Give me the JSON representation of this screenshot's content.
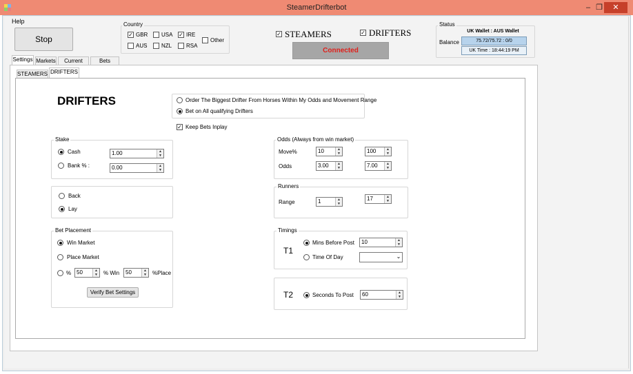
{
  "window": {
    "title": "SteamerDrifterbot",
    "minimize_glyph": "–",
    "restore_glyph": "❐",
    "close_glyph": "✕"
  },
  "menu": {
    "help": "Help"
  },
  "stop_button": "Stop",
  "country": {
    "legend": "Country",
    "options": [
      {
        "label": "GBR",
        "checked": true
      },
      {
        "label": "USA",
        "checked": false
      },
      {
        "label": "IRE",
        "checked": true
      },
      {
        "label": "AUS",
        "checked": false
      },
      {
        "label": "NZL",
        "checked": false
      },
      {
        "label": "RSA",
        "checked": false
      },
      {
        "label": "Other",
        "checked": false
      }
    ]
  },
  "mode": {
    "steamers_label": "STEAMERS",
    "steamers_checked": true,
    "drifters_label": "DRIFTERS",
    "drifters_checked": true
  },
  "connection": {
    "text": "Connected",
    "bg_color": "#a6a6a6",
    "text_color": "#e0201b"
  },
  "status": {
    "legend": "Status",
    "wallet_header": "UK Wallet : AUS Wallet",
    "balance_label": "Balance",
    "balance_value": "75.72/75.72 : 0/0",
    "uk_time": "UK Time : 18:44:19 PM"
  },
  "main_tabs": [
    "Settings",
    "Markets",
    "Current Bets",
    "Bets History"
  ],
  "sub_tabs": [
    "STEAMERS",
    "DRIFTERS"
  ],
  "drifters": {
    "heading": "DRIFTERS",
    "order_options": [
      {
        "label": "Order The Biggest Drifter From Horses Within My Odds and Movement Range",
        "selected": false
      },
      {
        "label": "Bet on All qualifying Drifters",
        "selected": true
      }
    ],
    "keep_inplay": {
      "label": "Keep Bets Inplay",
      "checked": true
    },
    "stake": {
      "legend": "Stake",
      "cash_label": "Cash",
      "cash_selected": true,
      "cash_value": "1.00",
      "bank_label": "Bank % :",
      "bank_selected": false,
      "bank_value": "0.00"
    },
    "side": {
      "back_label": "Back",
      "back_selected": false,
      "lay_label": "Lay",
      "lay_selected": true
    },
    "bet_placement": {
      "legend": "Bet Placement",
      "win_label": "Win Market",
      "win_selected": true,
      "place_label": "Place Market",
      "place_selected": false,
      "pct_label": "%",
      "pct_selected": false,
      "win_pct_value": "50",
      "win_pct_label": "% Win",
      "place_pct_value": "50",
      "place_pct_label": "%Place",
      "verify_button": "Verify Bet Settings"
    },
    "odds": {
      "legend": "Odds (Always from win market)",
      "move_label": "Move%",
      "move_min": "10",
      "move_max": "100",
      "odds_label": "Odds",
      "odds_min": "3.00",
      "odds_max": "7.00"
    },
    "runners": {
      "legend": "Runners",
      "range_label": "Range",
      "range_min": "1",
      "range_max": "17"
    },
    "timings": {
      "legend": "Timings",
      "t1_label": "T1",
      "mins_label": "Mins Before Post",
      "mins_selected": true,
      "mins_value": "10",
      "tod_label": "Time Of Day",
      "tod_selected": false,
      "tod_value": ""
    },
    "t2": {
      "label": "T2",
      "seconds_label": "Seconds To Post",
      "seconds_selected": true,
      "seconds_value": "60"
    }
  }
}
